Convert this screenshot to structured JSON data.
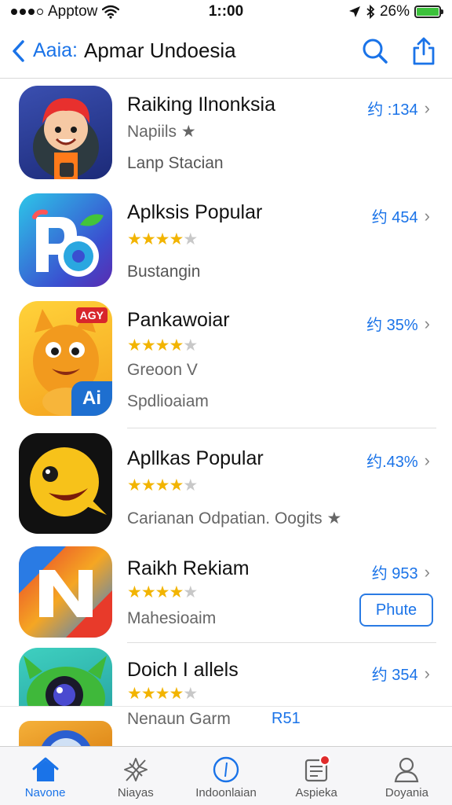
{
  "status_bar": {
    "carrier": "Apptow",
    "time": "1::00",
    "battery": "26%"
  },
  "nav": {
    "back_label": "Aaia:",
    "title": "Apmar Undoesia"
  },
  "apps": [
    {
      "title": "Raiking Ilnonksia",
      "line1": "Napiils ★",
      "line2": "Lanp Stacian",
      "price": "约 :134"
    },
    {
      "title": "Aplksis Popular",
      "rating": 3.5,
      "line2": "Bustangin",
      "price": "约 454"
    },
    {
      "title": "Pankawoiar",
      "rating": 3.5,
      "line1": "Greoon V",
      "line2": "Spdlioaiam",
      "price": "约 35%",
      "badge": "AGY",
      "corner": "Ai"
    },
    {
      "title": "Apllkas Popular",
      "rating": 3.5,
      "line2": "Carianan  Odpatian. Oogits ★",
      "price": "约.43%"
    },
    {
      "title": "Raikh Rekiam",
      "rating": 3.5,
      "line2": "Mahesioaim",
      "price": "约 953",
      "button": "Phute"
    },
    {
      "title": "Doich I allels",
      "rating": 3.5,
      "price": "约 354"
    }
  ],
  "partial_row": {
    "text": "Nenaun Garm",
    "tag": "R51"
  },
  "tab_bar": {
    "active": "home",
    "tabs": [
      {
        "id": "home",
        "label": "Navone",
        "icon": "house-icon"
      },
      {
        "id": "games",
        "label": "Niayas",
        "icon": "rocket-icon"
      },
      {
        "id": "indonesia",
        "label": "Indoonlaian",
        "icon": "compass-icon"
      },
      {
        "id": "apps",
        "label": "Aspieka",
        "icon": "document-icon"
      },
      {
        "id": "account",
        "label": "Doyania",
        "icon": "person-icon"
      }
    ]
  },
  "colors": {
    "accent": "#1a73e8",
    "star": "#f2b400",
    "star_off": "#c8c8c8",
    "battery": "#3cc13b"
  }
}
